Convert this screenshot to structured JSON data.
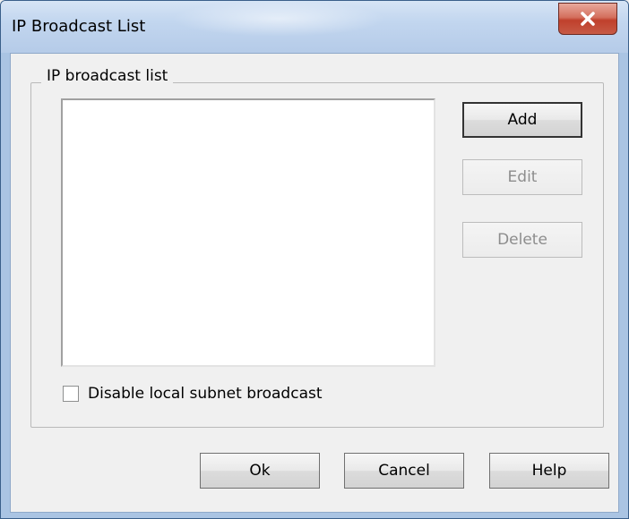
{
  "window": {
    "title": "IP Broadcast List"
  },
  "group": {
    "legend": "IP broadcast list"
  },
  "buttons": {
    "add": "Add",
    "edit": "Edit",
    "delete": "Delete",
    "ok": "Ok",
    "cancel": "Cancel",
    "help": "Help"
  },
  "checkbox": {
    "label": "Disable local subnet broadcast",
    "checked": false
  },
  "list": {
    "items": []
  },
  "icons": {
    "close": "close-icon"
  },
  "colors": {
    "close_button": "#c9493a",
    "title_bar": "#c2d6ef",
    "dialog_bg": "#f0f0f0"
  }
}
